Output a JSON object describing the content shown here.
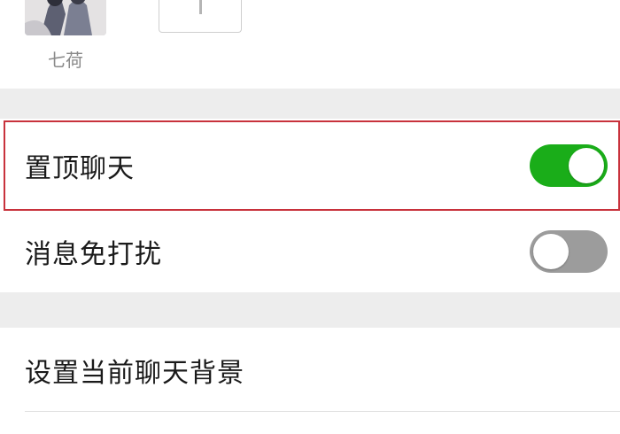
{
  "members": {
    "member_name": "七荷",
    "avatar_icon": "member-avatar-photo",
    "add_icon": "plus-icon"
  },
  "settings": {
    "pin_chat": {
      "label": "置顶聊天",
      "enabled": true
    },
    "mute_notifications": {
      "label": "消息免打扰",
      "enabled": false
    },
    "chat_background": {
      "label": "设置当前聊天背景"
    }
  },
  "colors": {
    "toggle_on": "#1aad19",
    "toggle_off": "#9c9c9c",
    "highlight_border": "#c8323c",
    "page_background": "#ededed"
  }
}
